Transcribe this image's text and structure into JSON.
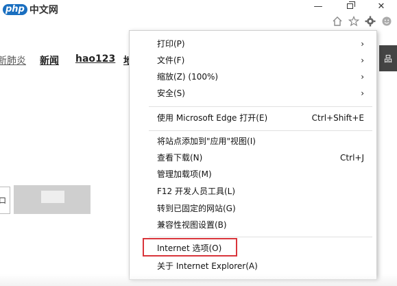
{
  "watermark": {
    "php": "php",
    "cn": "中文网"
  },
  "window_controls": {
    "minimize": "—",
    "restore": "",
    "close": "✕"
  },
  "toolbar_icons": [
    "home-icon",
    "star-icon",
    "gear-icon",
    "smiley-icon"
  ],
  "background_page": {
    "nav": [
      "新肺炎",
      "新闻",
      "hao123",
      "地"
    ],
    "side_button": "品",
    "search_left": "口"
  },
  "menu": {
    "items": [
      {
        "label": "打印(P)",
        "right": "›"
      },
      {
        "label": "文件(F)",
        "right": "›"
      },
      {
        "label": "缩放(Z) (100%)",
        "right": "›"
      },
      {
        "label": "安全(S)",
        "right": "›"
      },
      {
        "label": "使用 Microsoft Edge 打开(E)",
        "right": "Ctrl+Shift+E"
      },
      {
        "label": "将站点添加到\"应用\"视图(I)",
        "right": ""
      },
      {
        "label": "查看下载(N)",
        "right": "Ctrl+J"
      },
      {
        "label": "管理加载项(M)",
        "right": ""
      },
      {
        "label": "F12 开发人员工具(L)",
        "right": ""
      },
      {
        "label": "转到已固定的网站(G)",
        "right": ""
      },
      {
        "label": "兼容性视图设置(B)",
        "right": ""
      },
      {
        "label": "Internet 选项(O)",
        "right": ""
      },
      {
        "label": "关于 Internet Explorer(A)",
        "right": ""
      }
    ],
    "highlight_color": "#d9343a"
  }
}
